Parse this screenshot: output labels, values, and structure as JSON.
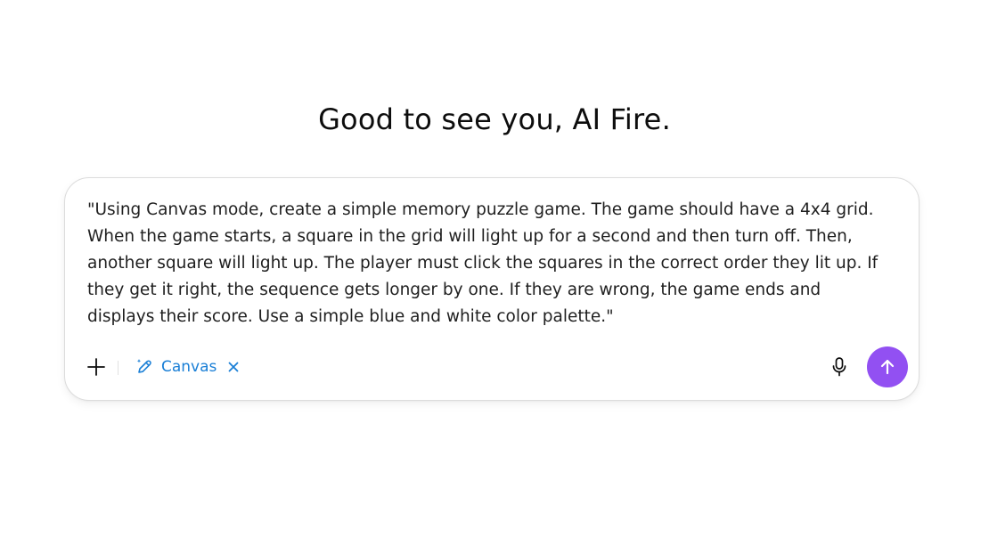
{
  "greeting": "Good to see you, AI Fire.",
  "composer": {
    "prompt": "\"Using Canvas mode, create a simple memory puzzle game. The game should have a 4x4 grid. When the game starts, a square in the grid will light up for a second and then turn off. Then, another square will light up. The player must click the squares in the correct order they lit up. If they get it right, the sequence gets longer by one. If they are wrong, the game ends and displays their score. Use a simple blue and white color palette.\"",
    "tool_chip": {
      "label": "Canvas",
      "icon": "pencil-sparkle-icon",
      "remove_icon": "close-icon",
      "color": "#1a7fd6"
    },
    "buttons": {
      "add": "plus-icon",
      "voice": "microphone-icon",
      "send": "arrow-up-icon"
    },
    "colors": {
      "send_button": "#9250f2",
      "border": "#dcdcdc"
    }
  }
}
